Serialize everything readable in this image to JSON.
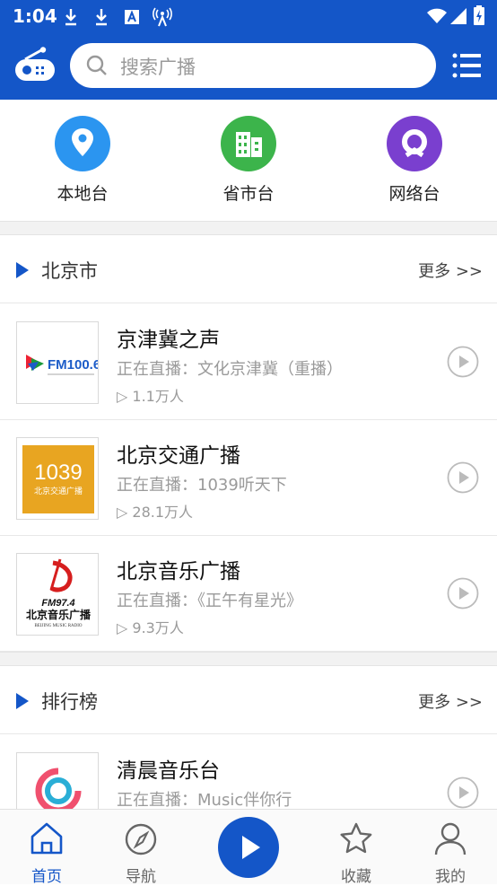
{
  "status_bar": {
    "time": "1:04"
  },
  "search": {
    "placeholder": "搜索广播"
  },
  "categories": [
    {
      "label": "本地台",
      "color": "#2b95f0",
      "icon": "location-pin-icon"
    },
    {
      "label": "省市台",
      "color": "#3cb44b",
      "icon": "buildings-icon"
    },
    {
      "label": "网络台",
      "color": "#7a3fcf",
      "icon": "network-q-icon"
    }
  ],
  "sections": [
    {
      "title": "北京市",
      "more": "更多 >>",
      "items": [
        {
          "name": "京津冀之声",
          "live": "正在直播：文化京津冀（重播）",
          "plays": "▷ 1.1万人",
          "logo_text": "FM100.6"
        },
        {
          "name": "北京交通广播",
          "live": "正在直播：1039听天下",
          "plays": "▷ 28.1万人",
          "logo_text": "1039",
          "logo_sub": "北京交通广播"
        },
        {
          "name": "北京音乐广播",
          "live": "正在直播：《正午有星光》",
          "plays": "▷ 9.3万人",
          "logo_text": "FM97.4",
          "logo_sub": "北京音乐广播",
          "logo_en": "BEIJING MUSIC RADIO"
        }
      ]
    },
    {
      "title": "排行榜",
      "more": "更多 >>",
      "items": [
        {
          "name": "清晨音乐台",
          "live": "正在直播：Music伴你行",
          "plays": ""
        }
      ]
    }
  ],
  "tabs": [
    {
      "label": "首页",
      "active": true,
      "icon": "home-icon"
    },
    {
      "label": "导航",
      "active": false,
      "icon": "compass-icon"
    },
    {
      "label": "收藏",
      "active": false,
      "icon": "star-icon"
    },
    {
      "label": "我的",
      "active": false,
      "icon": "user-icon"
    }
  ],
  "colors": {
    "primary": "#1456c8",
    "gray_text": "#9a9a9a"
  }
}
